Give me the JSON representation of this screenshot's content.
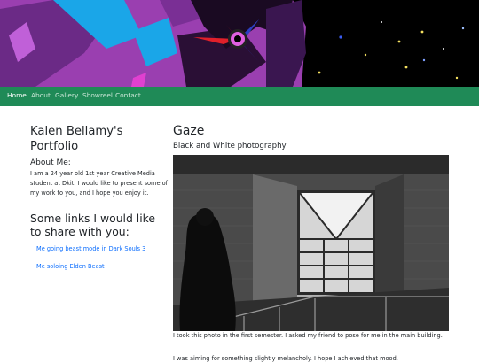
{
  "nav": {
    "items": [
      {
        "label": "Home",
        "active": true
      },
      {
        "label": "About",
        "active": false
      },
      {
        "label": "Gallery",
        "active": false
      },
      {
        "label": "Showreel",
        "active": false
      },
      {
        "label": "Contact",
        "active": false
      }
    ]
  },
  "sidebar": {
    "title": "Kalen Bellamy's Portfolio",
    "about_heading": "About Me:",
    "about_text": "I am a 24 year old 1st year Creative Media student at Dkit. I would like to present some of my work to you, and I hope you enjoy it.",
    "links_heading": "Some links I would like to share with you:",
    "links": [
      {
        "label": "Me going beast mode in Dark Souls 3"
      },
      {
        "label": "Me soloing Elden Beast"
      }
    ]
  },
  "post": {
    "title": "Gaze",
    "subtitle": "Black and White photography",
    "caption": "I took this photo in the first semester. I asked my friend to pose for me in the main building.",
    "caption_2": "I was aiming for something slightly melancholy. I hope I achieved that mood."
  },
  "colors": {
    "navbar": "#1f8a57",
    "link": "#0d6efd",
    "banner_purple": "#9a3fb0",
    "banner_blue": "#1aa6e8",
    "banner_red": "#e0202a"
  }
}
